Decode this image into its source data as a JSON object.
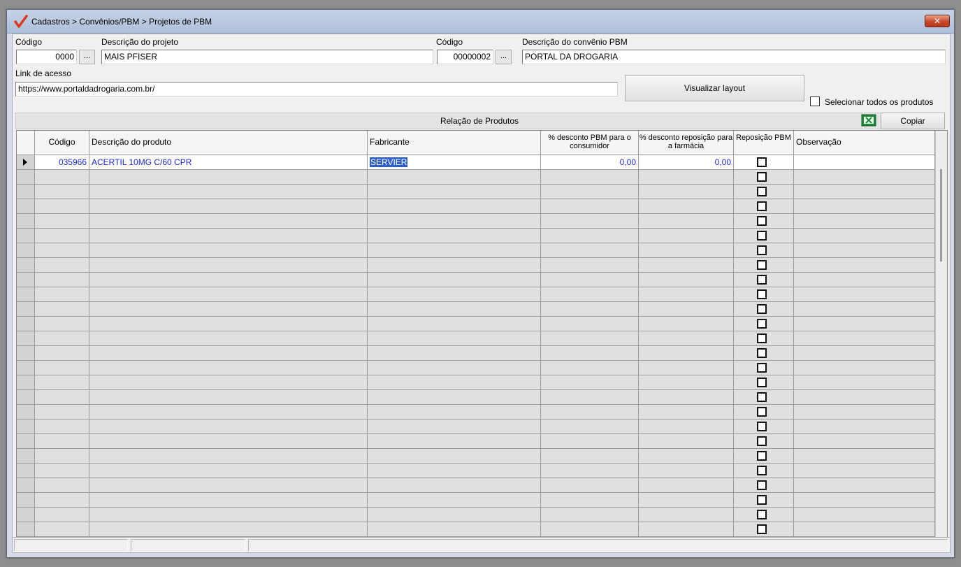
{
  "window": {
    "title": "Cadastros > Convênios/PBM > Projetos de PBM",
    "close_label": "✕",
    "accent": "#d9381e"
  },
  "form": {
    "codigo_label": "Código",
    "codigo_value": "0000",
    "lookup_label": "...",
    "descricao_projeto_label": "Descrição do projeto",
    "descricao_projeto_value": "MAIS PFISER",
    "codigo_convenio_label": "Código",
    "codigo_convenio_value": "00000002",
    "descricao_convenio_label": "Descrição do convênio PBM",
    "descricao_convenio_value": "PORTAL DA DROGARIA",
    "link_label": "Link de acesso",
    "link_value": "https://www.portaldadrogaria.com.br/",
    "visualizar_label": "Visualizar layout",
    "selecionar_todos_label": "Selecionar todos os produtos"
  },
  "grid": {
    "caption": "Relação de Produtos",
    "copiar_label": "Copiar",
    "columns": [
      {
        "key": "codigo",
        "label": "Código"
      },
      {
        "key": "descricao",
        "label": "Descrição do produto"
      },
      {
        "key": "fabricante",
        "label": "Fabricante"
      },
      {
        "key": "desc_consumidor",
        "label": "% desconto PBM para o consumidor"
      },
      {
        "key": "desc_farmacia",
        "label": "% desconto reposição para a farmácia"
      },
      {
        "key": "reposicao",
        "label": "Reposição PBM"
      },
      {
        "key": "observacao",
        "label": "Observação"
      }
    ],
    "rows": [
      {
        "codigo": "035966",
        "descricao": "ACERTIL 10MG C/60 CPR",
        "fabricante": "SERVIER",
        "desc_consumidor": "0,00",
        "desc_farmacia": "0,00",
        "reposicao": false,
        "observacao": ""
      }
    ],
    "empty_rows": 25,
    "text_color": "#1c2bd6"
  }
}
